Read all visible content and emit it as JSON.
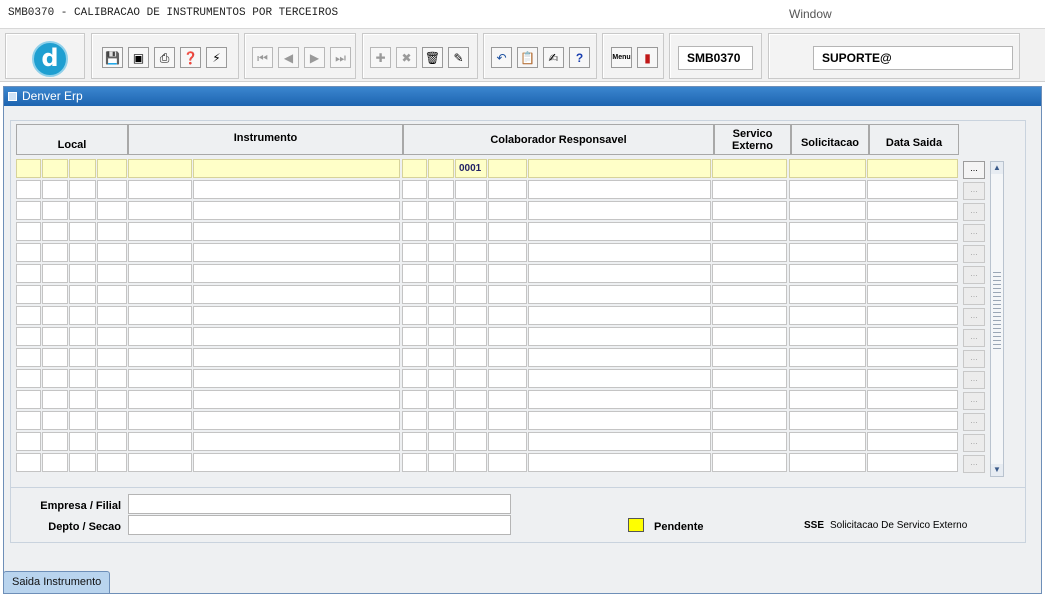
{
  "menubar": {
    "app_title": "SMB0370 - CALIBRACAO DE INSTRUMENTOS POR TERCEIROS",
    "window_menu": "Window"
  },
  "toolbar": {
    "logo_icon": "denver-logo-icon",
    "form_code": "SMB0370",
    "user": "SUPORTE@",
    "buttons_group1": [
      "save-icon",
      "window-icon",
      "print-icon",
      "query-help-icon",
      "wand-icon"
    ],
    "buttons_nav": [
      "first-record-icon",
      "prev-record-icon",
      "next-record-icon",
      "last-record-icon"
    ],
    "buttons_edit": [
      "insert-record-icon",
      "delete-record-icon",
      "clear-form-icon",
      "edit-icon"
    ],
    "buttons_tools": [
      "undo-icon",
      "clipboard-icon",
      "attach-icon",
      "help-icon"
    ],
    "buttons_misc": [
      "menu-icon",
      "exit-icon"
    ],
    "menu_button_text": "Menu"
  },
  "window": {
    "title": "Denver Erp"
  },
  "grid": {
    "headers": {
      "local": "Local",
      "instrumento": "Instrumento",
      "colaborador": "Colaborador Responsavel",
      "servico_externo": "Servico Externo",
      "solicitacao": "Solicitacao",
      "data_saida": "Data Saida"
    },
    "first_row_value": "0001",
    "lov_button": "...",
    "highlight_color": "#ffffc8"
  },
  "footer": {
    "empresa_label": "Empresa / Filial",
    "depto_label": "Depto / Secao",
    "legend_pendente": "Pendente",
    "legend_color": "#ffff00",
    "sse_abbr": "SSE",
    "sse_text": "Solicitacao De Servico Externo"
  },
  "tabs": {
    "active": "Saida Instrumento"
  }
}
